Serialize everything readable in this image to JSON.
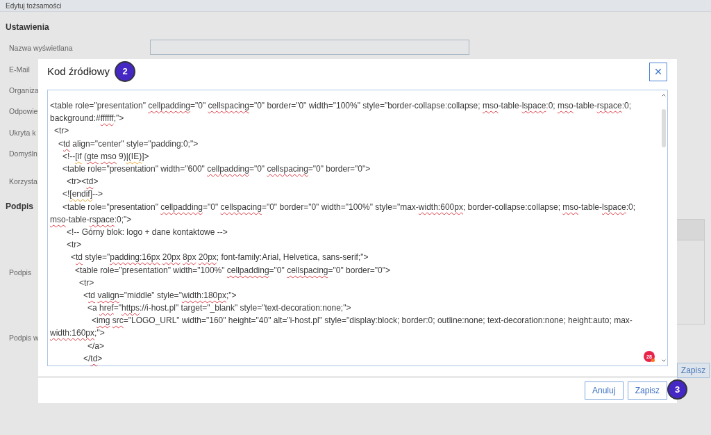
{
  "page": {
    "title": "Edytuj tożsamości",
    "settings_heading": "Ustawienia",
    "settings_rows": [
      {
        "label": "Nazwa wyświetlana",
        "kind": "input"
      },
      {
        "label": "E-Mail",
        "kind": "label"
      },
      {
        "label": "Organiza",
        "kind": "label"
      },
      {
        "label": "Odpowie",
        "kind": "label"
      },
      {
        "label": "Ukryta k",
        "kind": "label"
      },
      {
        "label": "Domyśln",
        "kind": "label"
      },
      {
        "label": "Korzysta",
        "kind": "label"
      }
    ],
    "signature_heading": "Podpis",
    "signature_rows": [
      {
        "label": "Podpis",
        "kind": "editor"
      },
      {
        "label": "Podpis w",
        "kind": "label"
      }
    ],
    "save_button": "Zapisz"
  },
  "dialog": {
    "title": "Kod źródłowy",
    "title_step_badge": "2",
    "editor": {
      "error_count": "28",
      "lines": [
        {
          "segments": [
            {
              "text": "<table role=\"presentation\" ",
              "kind": "plain"
            },
            {
              "text": "cellpadding",
              "kind": "spelling"
            },
            {
              "text": "=\"0\" ",
              "kind": "plain"
            },
            {
              "text": "cellspacing",
              "kind": "spelling"
            },
            {
              "text": "=\"0\" border=\"0\" width=\"100%\" style=\"border-collapse:collapse; ",
              "kind": "plain"
            },
            {
              "text": "mso",
              "kind": "spelling"
            },
            {
              "text": "-table-",
              "kind": "plain"
            },
            {
              "text": "lspace",
              "kind": "spelling"
            },
            {
              "text": ":0; ",
              "kind": "plain"
            },
            {
              "text": "mso",
              "kind": "spelling"
            },
            {
              "text": "-table-",
              "kind": "plain"
            },
            {
              "text": "rspace",
              "kind": "spelling"
            },
            {
              "text": ":0;",
              "kind": "plain"
            }
          ]
        },
        {
          "segments": [
            {
              "text": "background:#",
              "kind": "plain"
            },
            {
              "text": "ffffff",
              "kind": "spelling"
            },
            {
              "text": ";\">",
              "kind": "plain"
            }
          ]
        },
        {
          "segments": [
            {
              "text": "  <tr>",
              "kind": "plain"
            }
          ]
        },
        {
          "segments": [
            {
              "text": "    <",
              "kind": "plain"
            },
            {
              "text": "td",
              "kind": "spelling"
            },
            {
              "text": " align=\"center\" style=\"padding:0;\">",
              "kind": "plain"
            }
          ]
        },
        {
          "segments": [
            {
              "text": "      <!--",
              "kind": "plain"
            },
            {
              "text": "[if",
              "kind": "grammar"
            },
            {
              "text": " (",
              "kind": "plain"
            },
            {
              "text": "gte mso",
              "kind": "spelling"
            },
            {
              "text": " 9)",
              "kind": "plain"
            },
            {
              "text": "|(IE)",
              "kind": "grammar"
            },
            {
              "text": "]>",
              "kind": "plain"
            }
          ]
        },
        {
          "segments": [
            {
              "text": "      <table role=\"presentation\" width=\"600\" ",
              "kind": "plain"
            },
            {
              "text": "cellpadding",
              "kind": "spelling"
            },
            {
              "text": "=\"0\" ",
              "kind": "plain"
            },
            {
              "text": "cellspacing",
              "kind": "spelling"
            },
            {
              "text": "=\"0\" border=\"0\">",
              "kind": "plain"
            }
          ]
        },
        {
          "segments": [
            {
              "text": "        <tr><",
              "kind": "plain"
            },
            {
              "text": "td",
              "kind": "spelling"
            },
            {
              "text": ">",
              "kind": "plain"
            }
          ]
        },
        {
          "segments": [
            {
              "text": "      <!",
              "kind": "plain"
            },
            {
              "text": "[endif]",
              "kind": "grammar"
            },
            {
              "text": "-->",
              "kind": "plain"
            }
          ]
        },
        {
          "segments": [
            {
              "text": "      <table role=\"presentation\" ",
              "kind": "plain"
            },
            {
              "text": "cellpadding",
              "kind": "spelling"
            },
            {
              "text": "=\"0\" ",
              "kind": "plain"
            },
            {
              "text": "cellspacing",
              "kind": "spelling"
            },
            {
              "text": "=\"0\" border=\"0\" width=\"100%\" style=\"max-",
              "kind": "plain"
            },
            {
              "text": "width:600px",
              "kind": "spelling"
            },
            {
              "text": "; border-collapse:collapse; ",
              "kind": "plain"
            },
            {
              "text": "mso",
              "kind": "spelling"
            },
            {
              "text": "-table-",
              "kind": "plain"
            },
            {
              "text": "lspace",
              "kind": "spelling"
            },
            {
              "text": ":0;",
              "kind": "plain"
            }
          ]
        },
        {
          "segments": [
            {
              "text": "mso",
              "kind": "spelling"
            },
            {
              "text": "-table-",
              "kind": "plain"
            },
            {
              "text": "rspace",
              "kind": "spelling"
            },
            {
              "text": ":0;\">",
              "kind": "plain"
            }
          ]
        },
        {
          "segments": [
            {
              "text": "        <!-- Górny blok: logo + dane kontaktowe -->",
              "kind": "plain"
            }
          ]
        },
        {
          "segments": [
            {
              "text": "        <tr>",
              "kind": "plain"
            }
          ]
        },
        {
          "segments": [
            {
              "text": "          <",
              "kind": "plain"
            },
            {
              "text": "td",
              "kind": "spelling"
            },
            {
              "text": " style=\"",
              "kind": "plain"
            },
            {
              "text": "padding:16px 20px 8px 20px",
              "kind": "spelling"
            },
            {
              "text": "; font-family:Arial, Helvetica, sans-serif;\">",
              "kind": "plain"
            }
          ]
        },
        {
          "segments": [
            {
              "text": "            <table role=\"presentation\" width=\"100%\" ",
              "kind": "plain"
            },
            {
              "text": "cellpadding",
              "kind": "spelling"
            },
            {
              "text": "=\"0\" ",
              "kind": "plain"
            },
            {
              "text": "cellspacing",
              "kind": "spelling"
            },
            {
              "text": "=\"0\" border=\"0\">",
              "kind": "plain"
            }
          ]
        },
        {
          "segments": [
            {
              "text": "              <tr>",
              "kind": "plain"
            }
          ]
        },
        {
          "segments": [
            {
              "text": "                <",
              "kind": "plain"
            },
            {
              "text": "td valign",
              "kind": "spelling"
            },
            {
              "text": "=\"middle\" style=\"",
              "kind": "plain"
            },
            {
              "text": "width:180px",
              "kind": "spelling"
            },
            {
              "text": ";\">",
              "kind": "plain"
            }
          ]
        },
        {
          "segments": [
            {
              "text": "                  <a ",
              "kind": "plain"
            },
            {
              "text": "href",
              "kind": "spelling"
            },
            {
              "text": "=\"",
              "kind": "plain"
            },
            {
              "text": "https",
              "kind": "spelling"
            },
            {
              "text": "://i-host.pl\" target=\"_blank\" style=\"text-decoration:none;\">",
              "kind": "plain"
            }
          ]
        },
        {
          "segments": [
            {
              "text": "                    <",
              "kind": "plain"
            },
            {
              "text": "img src",
              "kind": "spelling"
            },
            {
              "text": "=\"LOGO_URL\" width=\"160\" height=\"40\" alt=\"i-host.pl\" style=\"display:block; border:0; outline:none; text-decoration:none; height:auto; max-",
              "kind": "plain"
            }
          ]
        },
        {
          "segments": [
            {
              "text": "width:160px",
              "kind": "spelling"
            },
            {
              "text": ";\">",
              "kind": "plain"
            }
          ]
        },
        {
          "segments": [
            {
              "text": "                  </a>",
              "kind": "plain"
            }
          ]
        },
        {
          "segments": [
            {
              "text": "                </",
              "kind": "plain"
            },
            {
              "text": "td",
              "kind": "spelling"
            },
            {
              "text": ">",
              "kind": "plain"
            }
          ]
        }
      ]
    },
    "buttons": [
      {
        "label": "Anuluj"
      },
      {
        "label": "Zapisz"
      }
    ],
    "footer_step_badge": "3"
  }
}
